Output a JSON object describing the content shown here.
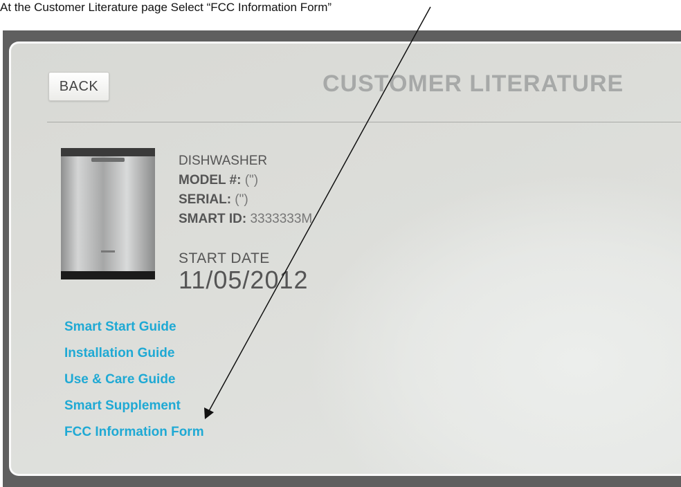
{
  "instruction": "At the Customer Literature page Select “FCC Information Form”",
  "header": {
    "back_label": "BACK",
    "title": "CUSTOMER LITERATURE"
  },
  "product": {
    "image_icon": "dishwasher-icon",
    "type": "DISHWASHER",
    "model_label": "MODEL #",
    "model_value": "(\")",
    "serial_label": "SERIAL",
    "serial_value": "(\")",
    "smart_id_label": "SMART ID",
    "smart_id_value": "3333333M",
    "start_date_label": "START DATE",
    "start_date_value": "11/05/2012"
  },
  "literature_links": [
    "Smart Start Guide",
    "Installation Guide",
    "Use & Care Guide",
    "Smart Supplement",
    "FCC Information Form"
  ],
  "colors": {
    "link": "#1fa9d4",
    "title": "#a7a9a8",
    "panel_bg": "#dcddd9"
  }
}
